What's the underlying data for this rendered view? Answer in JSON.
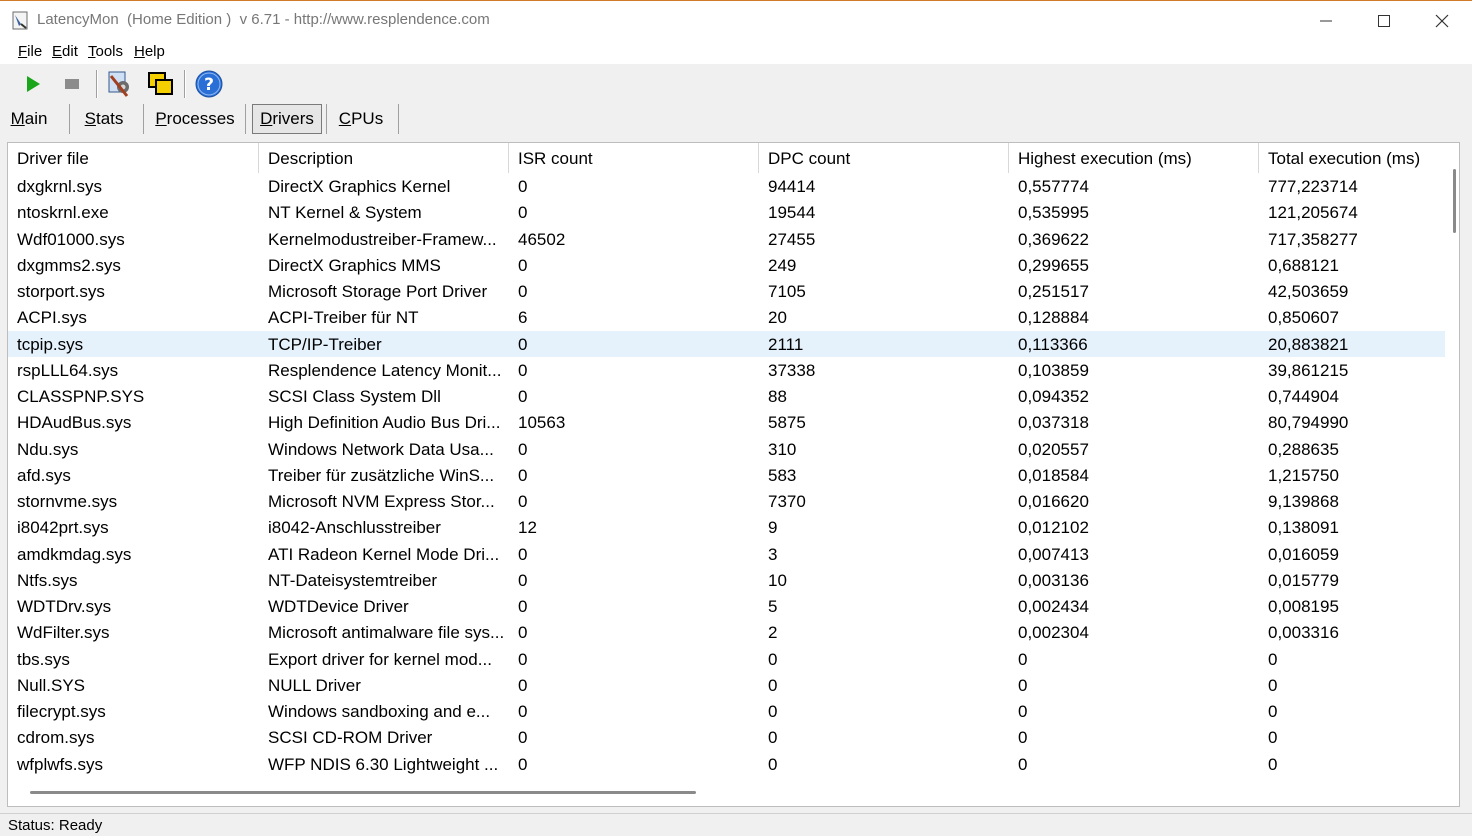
{
  "window": {
    "title": "LatencyMon  (Home Edition )  v 6.71 - http://www.resplendence.com"
  },
  "menu": [
    {
      "label": "File",
      "accel": "F",
      "rest": "ile"
    },
    {
      "label": "Edit",
      "accel": "E",
      "rest": "dit"
    },
    {
      "label": "Tools",
      "accel": "T",
      "rest": "ools"
    },
    {
      "label": "Help",
      "accel": "H",
      "rest": "elp"
    }
  ],
  "toolbar": {
    "icons": [
      "play-icon",
      "stop-icon",
      "gear-tools-icon",
      "copy-windows-icon",
      "help-icon"
    ],
    "colors": {
      "play": "#1aa51a",
      "stop": "#8c8c8c",
      "help": "#2a6fd6"
    }
  },
  "tabs": [
    {
      "label": "Main",
      "accel": "M",
      "rest": "ain",
      "active": false
    },
    {
      "label": "Stats",
      "accel": "S",
      "rest": "tats",
      "active": false
    },
    {
      "label": "Processes",
      "accel": "P",
      "rest": "rocesses",
      "active": false
    },
    {
      "label": "Drivers",
      "accel": "D",
      "rest": "rivers",
      "active": true
    },
    {
      "label": "CPUs",
      "accel": "C",
      "rest": "PUs",
      "active": false
    }
  ],
  "table": {
    "columns": [
      "Driver file",
      "Description",
      "ISR count",
      "DPC count",
      "Highest execution (ms)",
      "Total execution (ms)"
    ],
    "selected_row": 6,
    "rows": [
      [
        "dxgkrnl.sys",
        "DirectX Graphics Kernel",
        "0",
        "94414",
        "0,557774",
        "777,223714"
      ],
      [
        "ntoskrnl.exe",
        "NT Kernel & System",
        "0",
        "19544",
        "0,535995",
        "121,205674"
      ],
      [
        "Wdf01000.sys",
        "Kernelmodustreiber-Framew...",
        "46502",
        "27455",
        "0,369622",
        "717,358277"
      ],
      [
        "dxgmms2.sys",
        "DirectX Graphics MMS",
        "0",
        "249",
        "0,299655",
        "0,688121"
      ],
      [
        "storport.sys",
        "Microsoft Storage Port Driver",
        "0",
        "7105",
        "0,251517",
        "42,503659"
      ],
      [
        "ACPI.sys",
        "ACPI-Treiber für NT",
        "6",
        "20",
        "0,128884",
        "0,850607"
      ],
      [
        "tcpip.sys",
        "TCP/IP-Treiber",
        "0",
        "2111",
        "0,113366",
        "20,883821"
      ],
      [
        "rspLLL64.sys",
        "Resplendence Latency Monit...",
        "0",
        "37338",
        "0,103859",
        "39,861215"
      ],
      [
        "CLASSPNP.SYS",
        "SCSI Class System Dll",
        "0",
        "88",
        "0,094352",
        "0,744904"
      ],
      [
        "HDAudBus.sys",
        "High Definition Audio Bus Dri...",
        "10563",
        "5875",
        "0,037318",
        "80,794990"
      ],
      [
        "Ndu.sys",
        "Windows Network Data Usa...",
        "0",
        "310",
        "0,020557",
        "0,288635"
      ],
      [
        "afd.sys",
        "Treiber für zusätzliche WinS...",
        "0",
        "583",
        "0,018584",
        "1,215750"
      ],
      [
        "stornvme.sys",
        "Microsoft NVM Express Stor...",
        "0",
        "7370",
        "0,016620",
        "9,139868"
      ],
      [
        "i8042prt.sys",
        "i8042-Anschlusstreiber",
        "12",
        "9",
        "0,012102",
        "0,138091"
      ],
      [
        "amdkmdag.sys",
        "ATI Radeon Kernel Mode Dri...",
        "0",
        "3",
        "0,007413",
        "0,016059"
      ],
      [
        "Ntfs.sys",
        "NT-Dateisystemtreiber",
        "0",
        "10",
        "0,003136",
        "0,015779"
      ],
      [
        "WDTDrv.sys",
        "WDTDevice Driver",
        "0",
        "5",
        "0,002434",
        "0,008195"
      ],
      [
        "WdFilter.sys",
        "Microsoft antimalware file sys...",
        "0",
        "2",
        "0,002304",
        "0,003316"
      ],
      [
        "tbs.sys",
        "Export driver for kernel mod...",
        "0",
        "0",
        "0",
        "0"
      ],
      [
        "Null.SYS",
        "NULL Driver",
        "0",
        "0",
        "0",
        "0"
      ],
      [
        "filecrypt.sys",
        "Windows sandboxing and e...",
        "0",
        "0",
        "0",
        "0"
      ],
      [
        "cdrom.sys",
        "SCSI CD-ROM Driver",
        "0",
        "0",
        "0",
        "0"
      ],
      [
        "wfplwfs.sys",
        "WFP NDIS 6.30 Lightweight ...",
        "0",
        "0",
        "0",
        "0"
      ]
    ]
  },
  "status": {
    "text": "Status: Ready"
  }
}
